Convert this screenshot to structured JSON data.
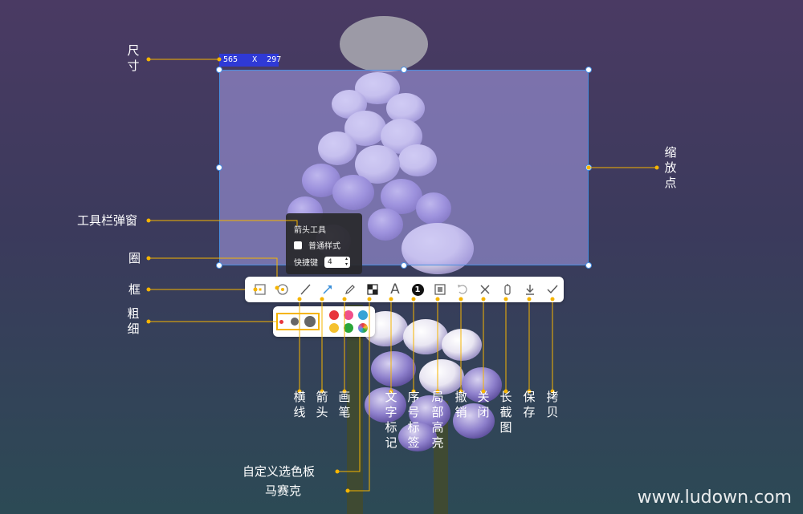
{
  "selection": {
    "size_text": "565   X  297"
  },
  "popup": {
    "title": "箭头工具",
    "checkbox_label": "普通样式",
    "shortcut_label": "快捷键",
    "shortcut_value": "4"
  },
  "toolbar": {
    "tools": [
      {
        "name": "rectangle-tool",
        "icon": "rect-icon"
      },
      {
        "name": "circle-tool",
        "icon": "circle-icon"
      },
      {
        "name": "line-tool",
        "icon": "line-icon"
      },
      {
        "name": "arrow-tool",
        "icon": "arrow-icon"
      },
      {
        "name": "pen-tool",
        "icon": "pen-icon"
      },
      {
        "name": "mosaic-tool",
        "icon": "mosaic-icon"
      },
      {
        "name": "text-tool",
        "icon": "text-icon",
        "glyph": "A"
      },
      {
        "name": "number-tool",
        "icon": "number-icon",
        "glyph": "1"
      },
      {
        "name": "highlight-tool",
        "icon": "highlight-icon"
      },
      {
        "name": "undo-tool",
        "icon": "undo-icon"
      },
      {
        "name": "close-tool",
        "icon": "close-icon"
      },
      {
        "name": "long-screenshot-tool",
        "icon": "long-screenshot-icon"
      },
      {
        "name": "save-tool",
        "icon": "download-icon"
      },
      {
        "name": "copy-tool",
        "icon": "check-icon"
      }
    ]
  },
  "palette": {
    "colors": [
      "#e8353c",
      "#f0508a",
      "#35a3d6",
      "#f5c12e",
      "#2aa63a",
      "#a070d8"
    ],
    "accent": "#f5b400"
  },
  "labels": {
    "size": "尺寸",
    "zoom_point": "缩放点",
    "toolbar_popup": "工具栏弹窗",
    "circle": "圈",
    "frame": "框",
    "thickness": "粗细",
    "line": "横线",
    "arrow": "箭头",
    "pen": "画笔",
    "text_mark": "文字标记",
    "number_tag": "序号标签",
    "local_highlight": "局部高亮",
    "undo": "撤销",
    "close": "关闭",
    "long_screenshot": "长截图",
    "save": "保存",
    "copy": "拷贝",
    "custom_palette": "自定义选色板",
    "mosaic": "马赛克"
  },
  "watermark": "www.ludown.com"
}
